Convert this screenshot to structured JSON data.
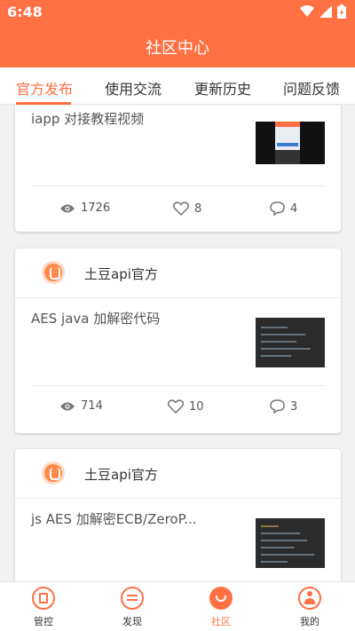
{
  "status": {
    "time": "6:48"
  },
  "header": {
    "title": "社区中心"
  },
  "tabs": [
    {
      "label": "官方发布",
      "active": true
    },
    {
      "label": "使用交流",
      "active": false
    },
    {
      "label": "更新历史",
      "active": false
    },
    {
      "label": "问题反馈",
      "active": false
    }
  ],
  "posts": [
    {
      "title": "iapp 对接教程视频",
      "views": "1726",
      "likes": "8",
      "comments": "4"
    },
    {
      "author": "土豆api官方",
      "title": "AES java 加解密代码",
      "views": "714",
      "likes": "10",
      "comments": "3"
    },
    {
      "author": "土豆api官方",
      "title": "js AES 加解密ECB/ZeroP..."
    }
  ],
  "bottom_nav": [
    {
      "label": "管控",
      "icon": "manage-icon",
      "active": false
    },
    {
      "label": "发现",
      "icon": "discover-icon",
      "active": false
    },
    {
      "label": "社区",
      "icon": "community-icon",
      "active": true
    },
    {
      "label": "我的",
      "icon": "profile-icon",
      "active": false
    }
  ],
  "colors": {
    "accent": "#ff7043"
  }
}
